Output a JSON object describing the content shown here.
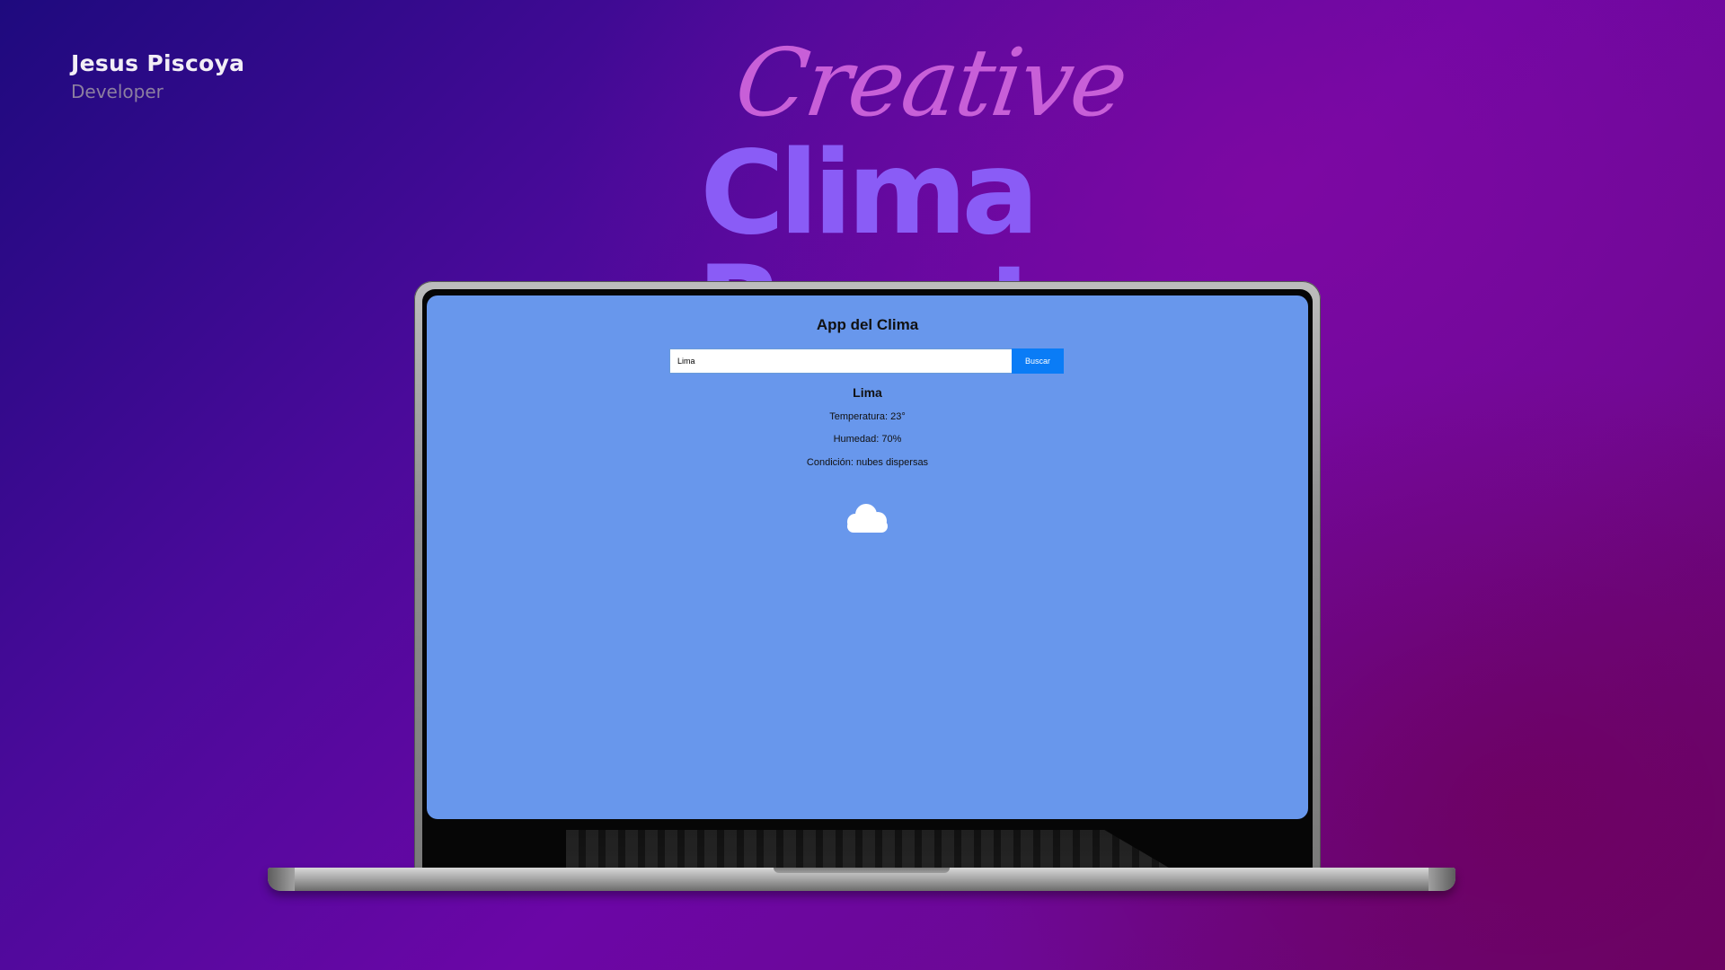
{
  "author": {
    "name": "Jesus Piscoya",
    "role": "Developer"
  },
  "hero": {
    "script_title": "Creative",
    "main_title": "Clima React"
  },
  "app": {
    "title": "App del Clima",
    "search": {
      "value": "Lima",
      "button_label": "Buscar"
    },
    "result": {
      "city": "Lima",
      "temperature": "Temperatura: 23°",
      "humidity": "Humedad: 70%",
      "condition": "Condición: nubes dispersas",
      "icon": "cloud-icon"
    }
  },
  "colors": {
    "screen_bg": "#6897ec",
    "button_bg": "#0a7cf6",
    "title_main": "#8a5cf6",
    "title_script": "#c85fd8"
  }
}
